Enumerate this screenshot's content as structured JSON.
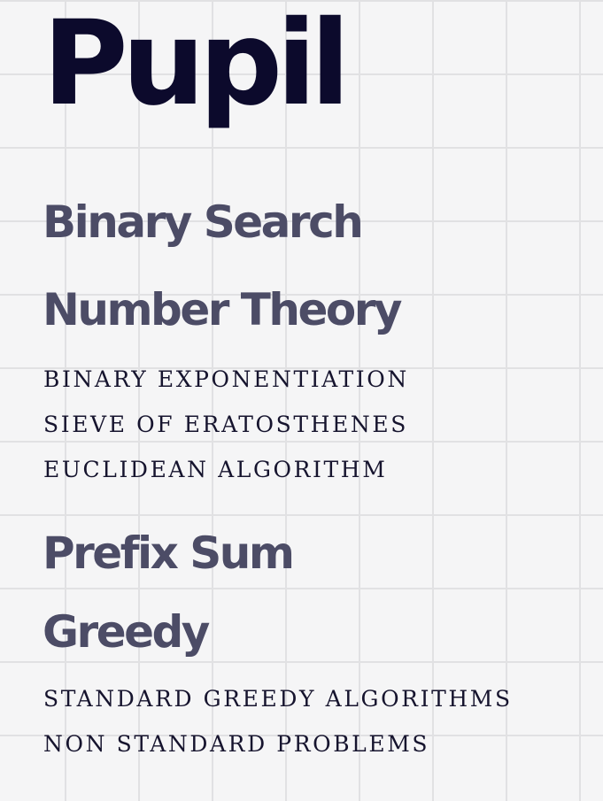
{
  "title": "Pupil",
  "sections": [
    {
      "heading": "Binary Search",
      "items": []
    },
    {
      "heading": "Number Theory",
      "items": [
        "BINARY EXPONENTIATION",
        "SIEVE OF ERATOSTHENES",
        "EUCLIDEAN ALGORITHM"
      ]
    },
    {
      "heading": "Prefix Sum",
      "items": []
    },
    {
      "heading": "Greedy",
      "items": [
        "STANDARD GREEDY ALGORITHMS",
        "NON STANDARD PROBLEMS"
      ]
    }
  ],
  "colors": {
    "background": "#f5f5f6",
    "grid": "#e1e1e3",
    "title": "#0c0a2c",
    "heading": "#4c4c66",
    "item": "#16142e"
  }
}
